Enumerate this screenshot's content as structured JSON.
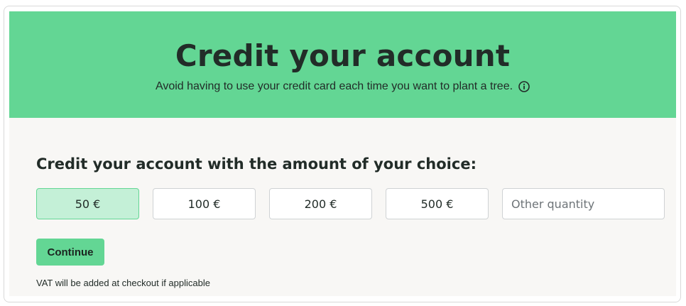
{
  "header": {
    "title": "Credit your account",
    "subtitle": "Avoid having to use your credit card each time you want to plant a tree.",
    "info_icon": "info-circle-icon"
  },
  "credit_form": {
    "heading": "Credit your account with the amount of your choice:",
    "amounts": [
      {
        "label": "50 €",
        "selected": true
      },
      {
        "label": "100 €",
        "selected": false
      },
      {
        "label": "200 €",
        "selected": false
      },
      {
        "label": "500 €",
        "selected": false
      }
    ],
    "other_quantity": {
      "value": "",
      "placeholder": "Other quantity"
    },
    "continue_label": "Continue",
    "vat_note": "VAT will be added at checkout if applicable"
  },
  "colors": {
    "brand_green": "#63d694",
    "selected_fill": "#c4f0d7",
    "panel_bg": "#f8f7f5",
    "text_dark": "#222c28"
  }
}
